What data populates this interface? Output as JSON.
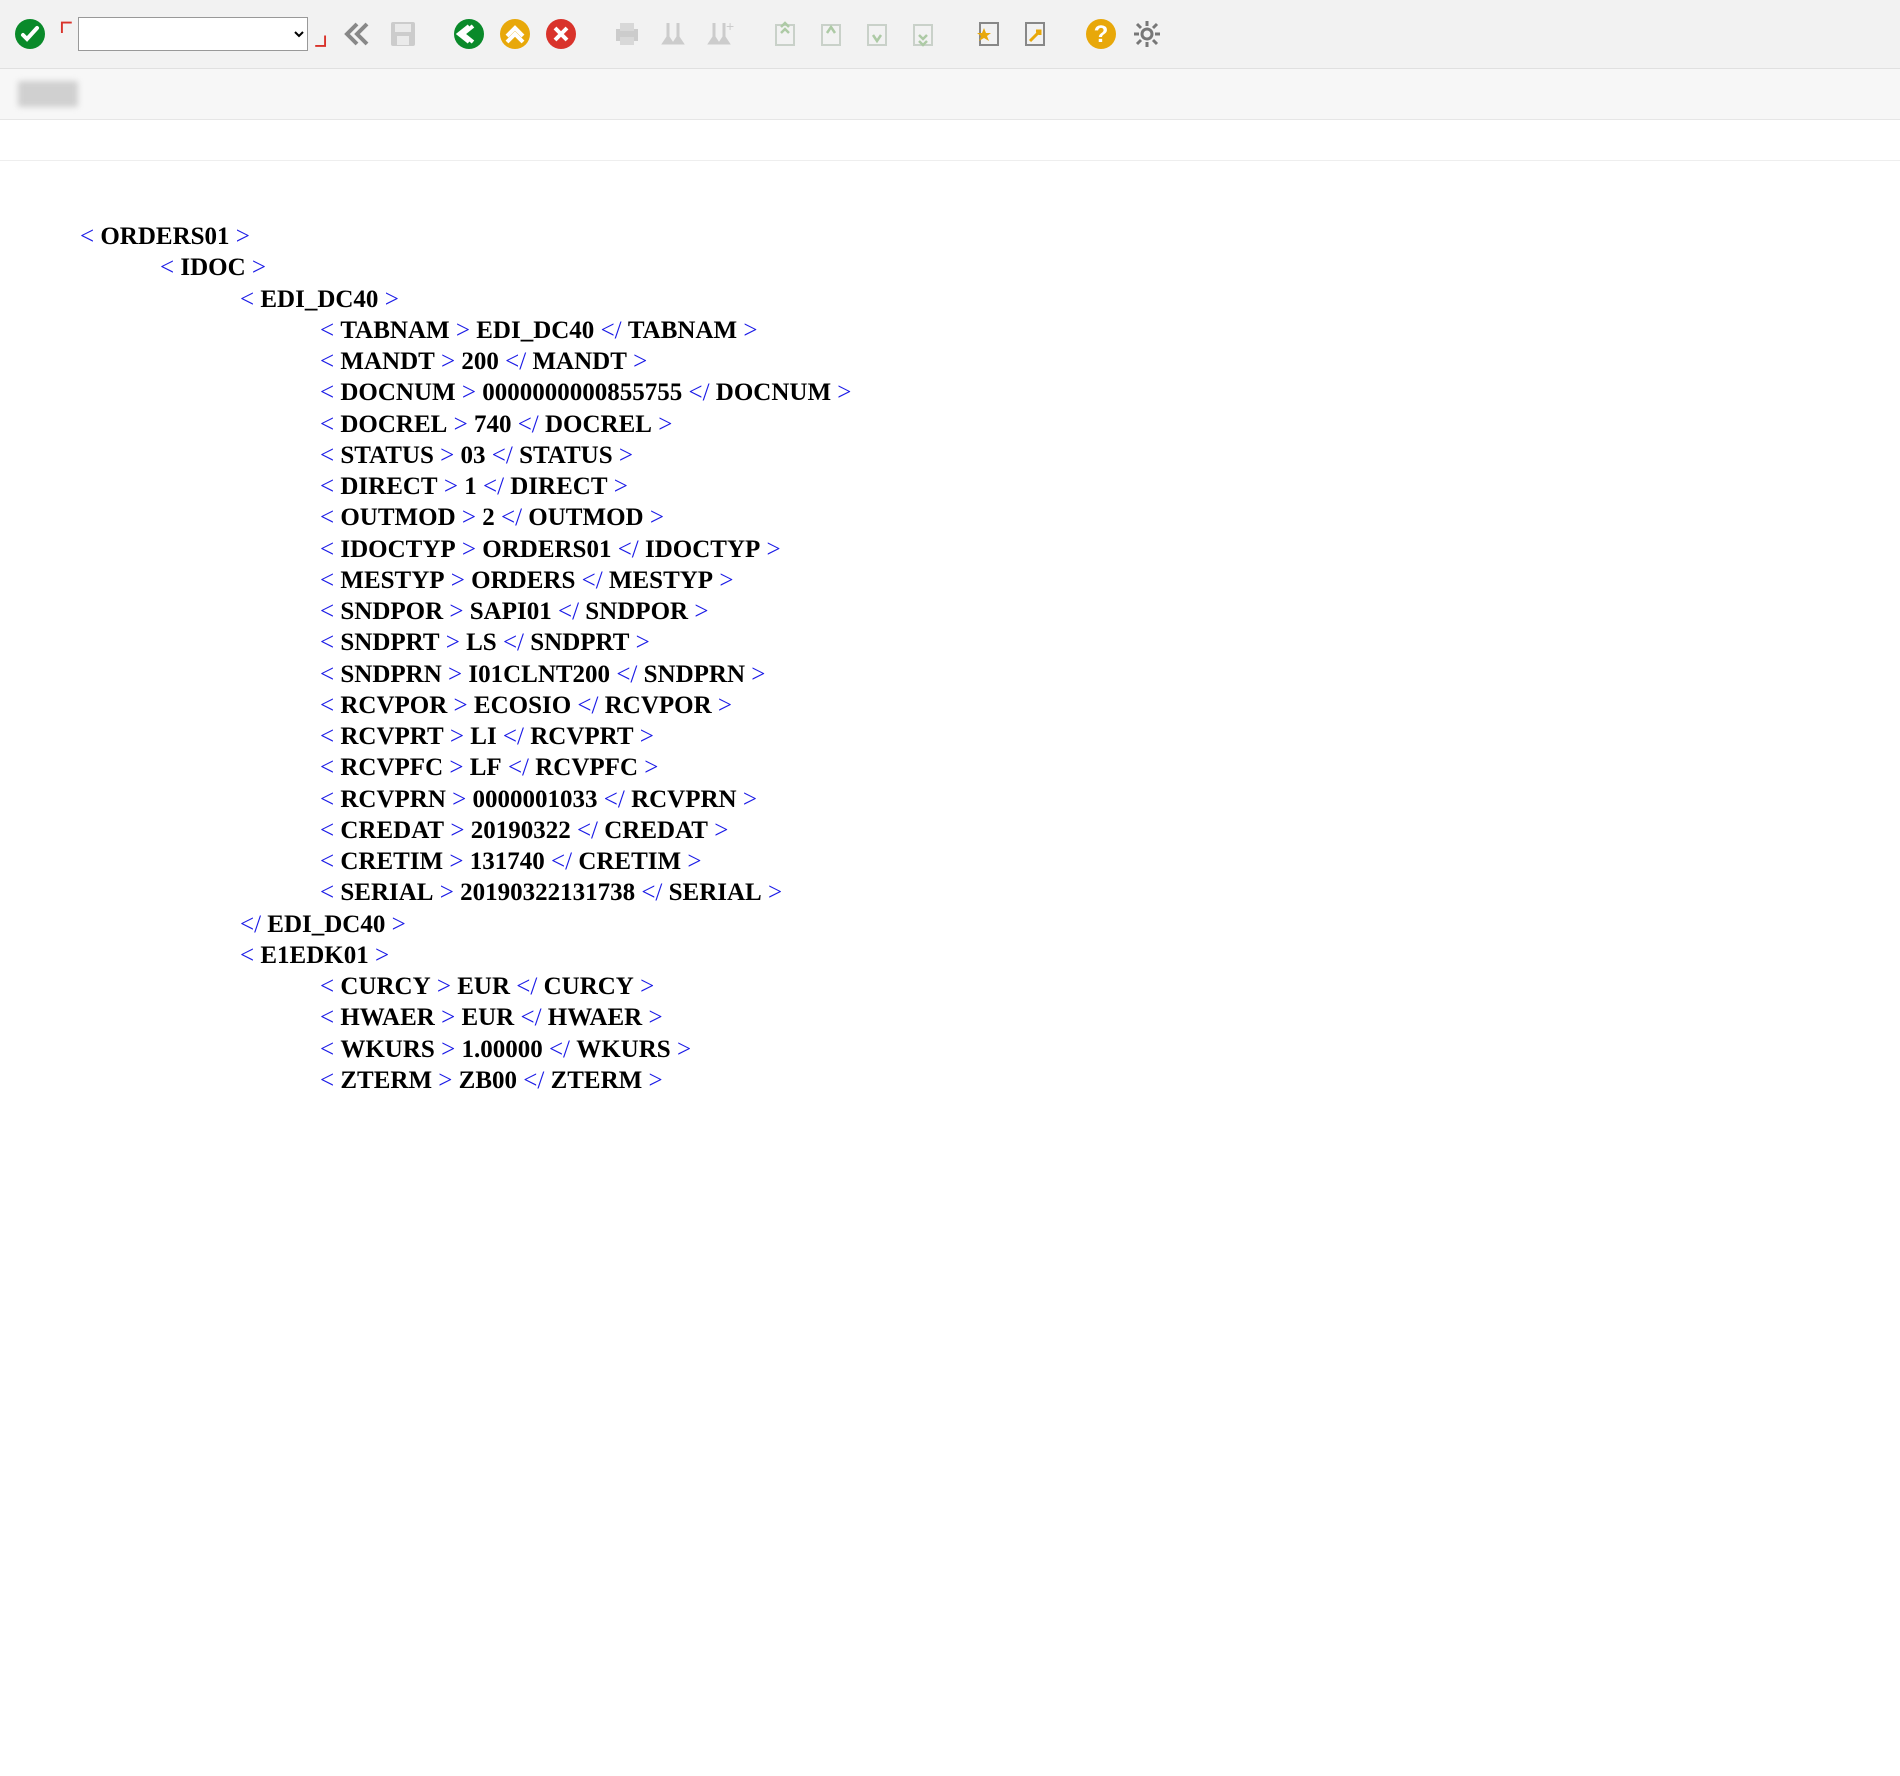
{
  "toolbar": {
    "command_value": "",
    "icons": {
      "ok": "ok-icon",
      "back_double": "double-back-icon",
      "save": "save-icon",
      "exit_green": "exit-green-icon",
      "up_orange": "up-orange-icon",
      "cancel_red": "cancel-red-icon",
      "print": "print-icon",
      "find": "find-icon",
      "find_next": "find-next-icon",
      "page2": "page-arrows-2-icon",
      "page3": "page-arrows-3-icon",
      "page4": "page-arrows-4-icon",
      "page1": "page-arrows-1-icon",
      "fav": "favorite-icon",
      "shortcut": "shortcut-icon",
      "help": "help-icon",
      "settings": "settings-icon"
    }
  },
  "xml": {
    "root": "ORDERS01",
    "idoc": "IDOC",
    "control": "EDI_DC40",
    "control_fields": [
      {
        "k": "TABNAM",
        "v": "EDI_DC40"
      },
      {
        "k": "MANDT",
        "v": "200"
      },
      {
        "k": "DOCNUM",
        "v": "0000000000855755"
      },
      {
        "k": "DOCREL",
        "v": "740"
      },
      {
        "k": "STATUS",
        "v": "03"
      },
      {
        "k": "DIRECT",
        "v": "1"
      },
      {
        "k": "OUTMOD",
        "v": "2"
      },
      {
        "k": "IDOCTYP",
        "v": "ORDERS01"
      },
      {
        "k": "MESTYP",
        "v": "ORDERS"
      },
      {
        "k": "SNDPOR",
        "v": "SAPI01"
      },
      {
        "k": "SNDPRT",
        "v": "LS"
      },
      {
        "k": "SNDPRN",
        "v": "I01CLNT200"
      },
      {
        "k": "RCVPOR",
        "v": "ECOSIO"
      },
      {
        "k": "RCVPRT",
        "v": "LI"
      },
      {
        "k": "RCVPFC",
        "v": "LF"
      },
      {
        "k": "RCVPRN",
        "v": "0000001033"
      },
      {
        "k": "CREDAT",
        "v": "20190322"
      },
      {
        "k": "CRETIM",
        "v": "131740"
      },
      {
        "k": "SERIAL",
        "v": "20190322131738"
      }
    ],
    "e1edk01": "E1EDK01",
    "e1edk01_fields": [
      {
        "k": "CURCY",
        "v": "EUR"
      },
      {
        "k": "HWAER",
        "v": "EUR"
      },
      {
        "k": "WKURS",
        "v": "1.00000"
      },
      {
        "k": "ZTERM",
        "v": "ZB00"
      }
    ]
  }
}
